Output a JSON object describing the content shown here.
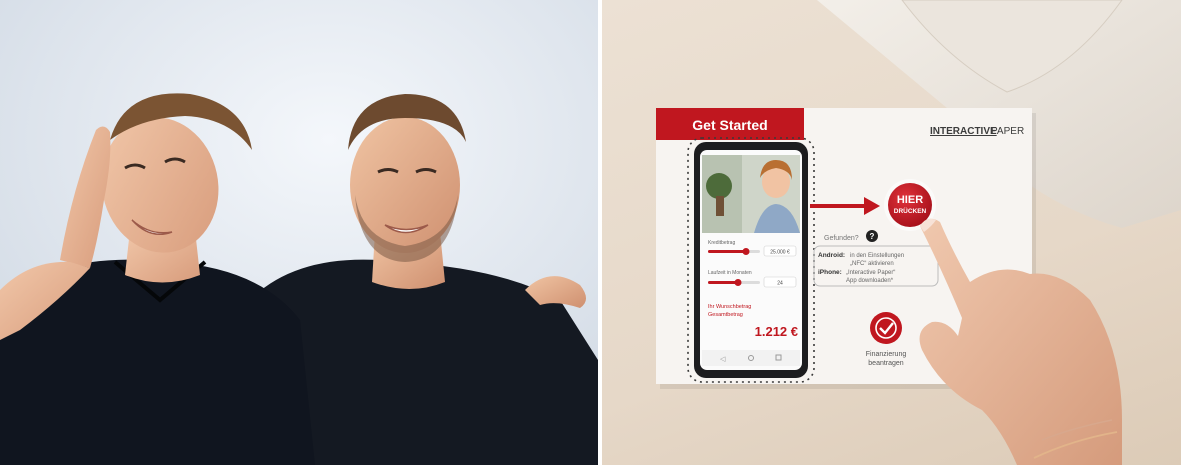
{
  "left_photo": {
    "subject": "two young men smiling, arms around each other",
    "shirt_color": "#10151f",
    "background_color": "#e3e9f1"
  },
  "right_photo": {
    "card": {
      "banner_label": "Get Started",
      "brand_interactive": "INTERACTIVE",
      "brand_paper": "PAPER",
      "button_line1": "HIER",
      "button_line2": "DRÜCKEN",
      "help_question": "Gefunden?",
      "android_label": "Android:",
      "android_text_line1": "in den Einstellungen",
      "android_text_line2": "„NFC“ aktivieren",
      "iphone_label": "iPhone:",
      "iphone_text_line1": "„Interactive Paper“",
      "iphone_text_line2": "App downloaden*",
      "finance_line1": "Finanzierung",
      "finance_line2": "beantragen",
      "accent_color": "#c0171f"
    },
    "phone": {
      "slider1_label": "Kreditbetrag",
      "slider1_value": "25.000 €",
      "slider2_label": "Laufzeit in Monaten",
      "slider2_value": "24",
      "rate_line1": "Ihr Wunschbetrag",
      "rate_line2": "Gesamtbetrag",
      "amount": "1.212 €"
    }
  }
}
